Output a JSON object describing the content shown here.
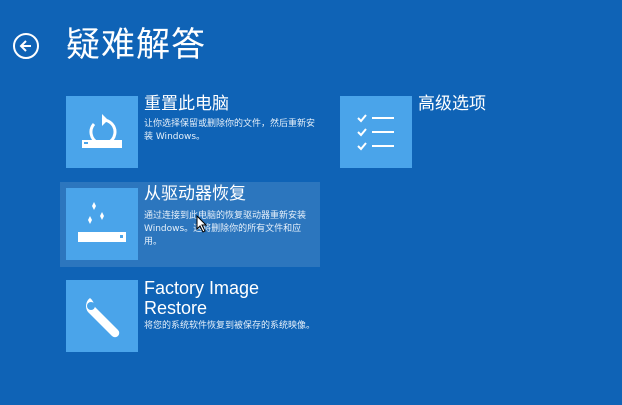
{
  "header": {
    "title": "疑难解答"
  },
  "options": [
    {
      "title": "重置此电脑",
      "description": "让你选择保留或删除你的文件，然后重新安装 Windows。",
      "icon": "reset-pc-icon"
    },
    {
      "title": "从驱动器恢复",
      "description": "通过连接到此电脑的恢复驱动器重新安装 Windows。这将删除你的所有文件和应用。",
      "icon": "recovery-drive-icon"
    },
    {
      "title": "Factory Image Restore",
      "description": "将您的系统软件恢复到被保存的系统映像。",
      "icon": "wrench-icon"
    },
    {
      "title": "高级选项",
      "description": "",
      "icon": "checklist-icon"
    }
  ],
  "colors": {
    "background": "#0f63b6",
    "tile_icon": "#4aa4ea",
    "highlight": "rgba(255,255,255,0.12)"
  }
}
